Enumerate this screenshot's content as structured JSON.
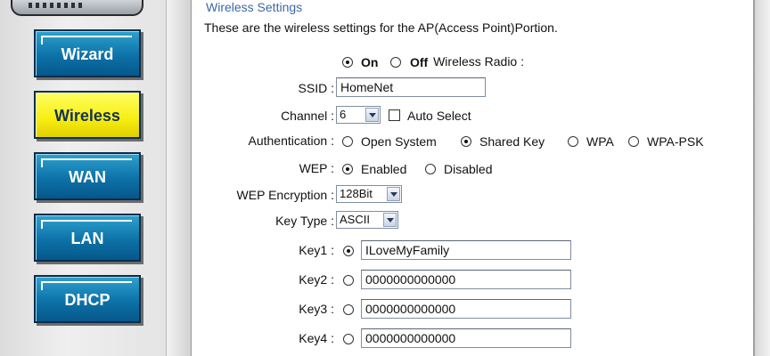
{
  "sidebar": {
    "items": [
      {
        "label": "Wizard"
      },
      {
        "label": "Wireless"
      },
      {
        "label": "WAN"
      },
      {
        "label": "LAN"
      },
      {
        "label": "DHCP"
      }
    ],
    "active": "Wireless"
  },
  "section": {
    "title": "Wireless Settings",
    "description": "These are the wireless settings for the AP(Access Point)Portion."
  },
  "form": {
    "wireless_radio": {
      "label": "Wireless Radio :",
      "options": [
        "On",
        "Off"
      ],
      "selected": "On"
    },
    "ssid": {
      "label": "SSID :",
      "value": "HomeNet"
    },
    "channel": {
      "label": "Channel :",
      "value": "6",
      "auto_select_label": "Auto Select",
      "auto_select_checked": false
    },
    "authentication": {
      "label": "Authentication :",
      "options": [
        "Open System",
        "Shared Key",
        "WPA",
        "WPA-PSK"
      ],
      "selected": "Shared Key"
    },
    "wep": {
      "label": "WEP :",
      "options": [
        "Enabled",
        "Disabled"
      ],
      "selected": "Enabled"
    },
    "wep_encryption": {
      "label": "WEP Encryption :",
      "value": "128Bit"
    },
    "key_type": {
      "label": "Key Type :",
      "value": "ASCII"
    },
    "keys": [
      {
        "label": "Key1 :",
        "value": "ILoveMyFamily",
        "selected": true
      },
      {
        "label": "Key2 :",
        "value": "0000000000000",
        "selected": false
      },
      {
        "label": "Key3 :",
        "value": "0000000000000",
        "selected": false
      },
      {
        "label": "Key4 :",
        "value": "0000000000000",
        "selected": false
      }
    ]
  },
  "colors": {
    "nav_button": "#0d72a8",
    "nav_active": "#f7ee10",
    "title": "#3e67a8"
  },
  "icons": [
    "router-device-icon",
    "radio-icon",
    "checkbox-icon",
    "chevron-down-icon"
  ]
}
